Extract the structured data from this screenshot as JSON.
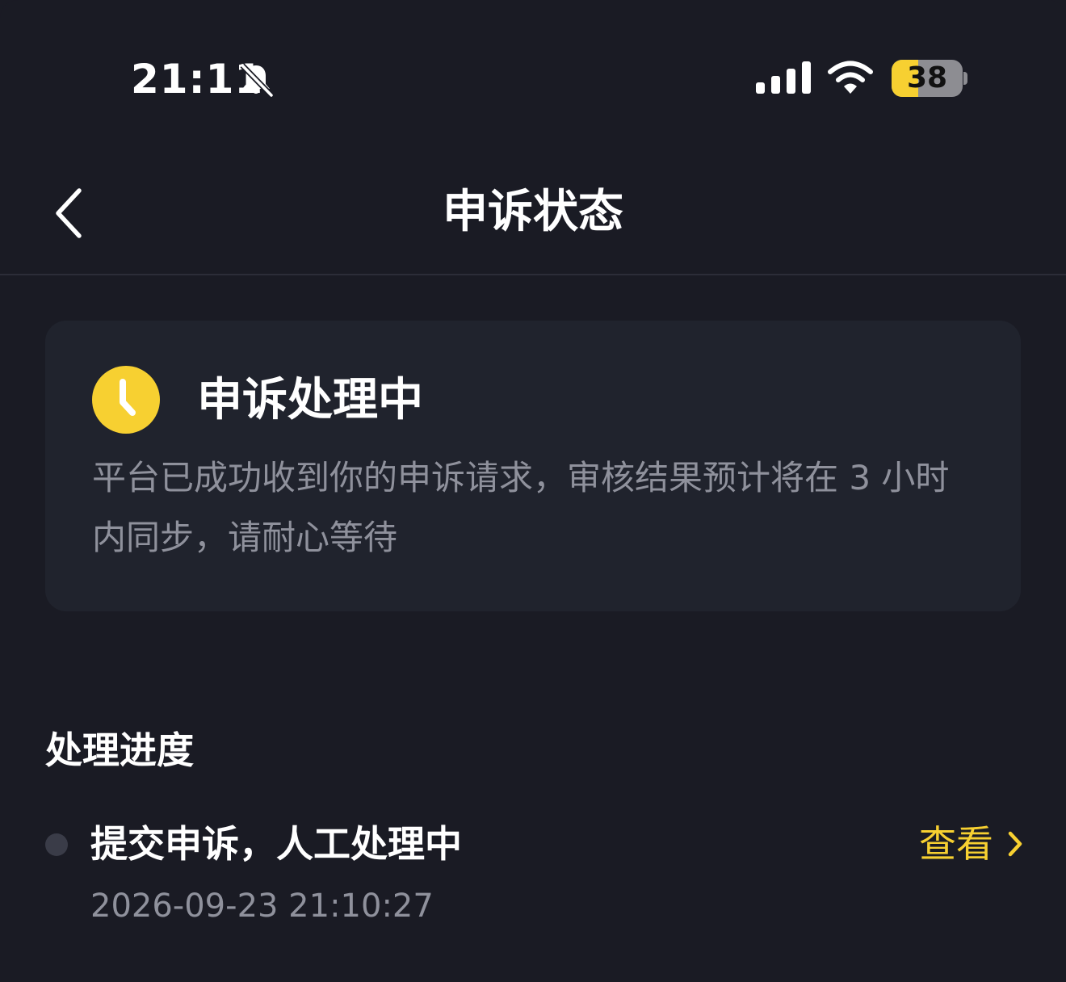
{
  "status_bar": {
    "time": "21:11",
    "battery_percent": 38,
    "battery_text": "38",
    "icons": [
      "bell-off-icon",
      "signal-icon",
      "wifi-icon",
      "battery-icon"
    ]
  },
  "nav": {
    "title": "申诉状态",
    "back_icon": "chevron-left-icon"
  },
  "status_card": {
    "icon": "clock-icon",
    "title": "申诉处理中",
    "description": "平台已成功收到你的申诉请求，审核结果预计将在 3 小时内同步，请耐心等待"
  },
  "progress": {
    "section_title": "处理进度",
    "items": [
      {
        "title": "提交申诉，人工处理中",
        "time": "2026-09-23 21:10:27",
        "action_label": "查看"
      }
    ]
  },
  "colors": {
    "background": "#1a1b24",
    "card": "#20232d",
    "accent": "#f7d031",
    "secondary_text": "#8f919c"
  }
}
